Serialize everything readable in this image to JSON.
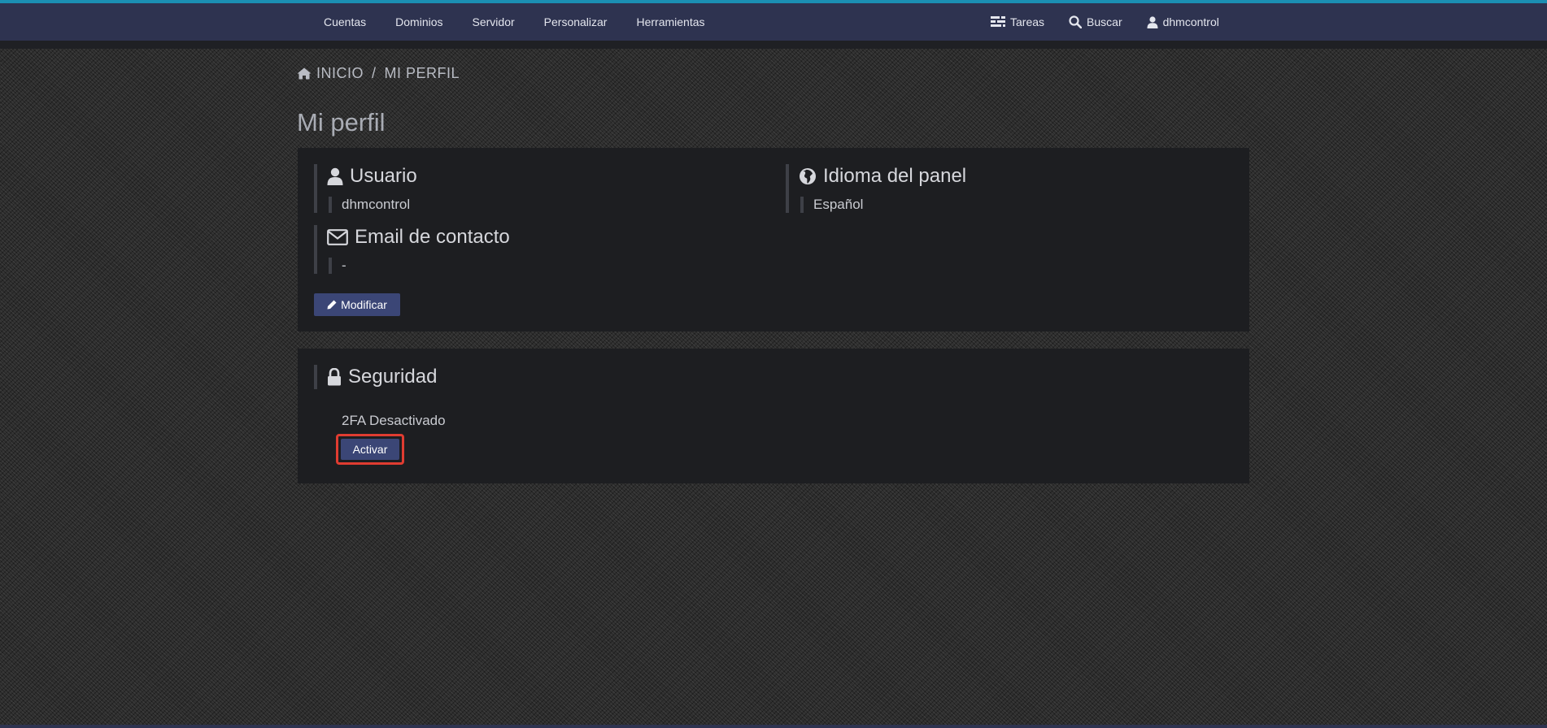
{
  "nav": {
    "items": [
      "Cuentas",
      "Dominios",
      "Servidor",
      "Personalizar",
      "Herramientas"
    ],
    "tasks_label": "Tareas",
    "search_label": "Buscar",
    "user_label": "dhmcontrol"
  },
  "breadcrumb": {
    "home": "INICIO",
    "separator": "/",
    "current": "MI PERFIL"
  },
  "page": {
    "title": "Mi perfil"
  },
  "profile": {
    "user_heading": "Usuario",
    "user_value": "dhmcontrol",
    "email_heading": "Email de contacto",
    "email_value": "-",
    "language_heading": "Idioma del panel",
    "language_value": "Español",
    "modify_label": "Modificar"
  },
  "security": {
    "heading": "Seguridad",
    "status": "2FA Desactivado",
    "activate_label": "Activar"
  },
  "colors": {
    "nav_bg": "#2e3350",
    "nav_accent": "#1b8fb3",
    "panel_bg": "#1d1e21",
    "button_bg": "#3b4676",
    "highlight": "#e03c31"
  }
}
